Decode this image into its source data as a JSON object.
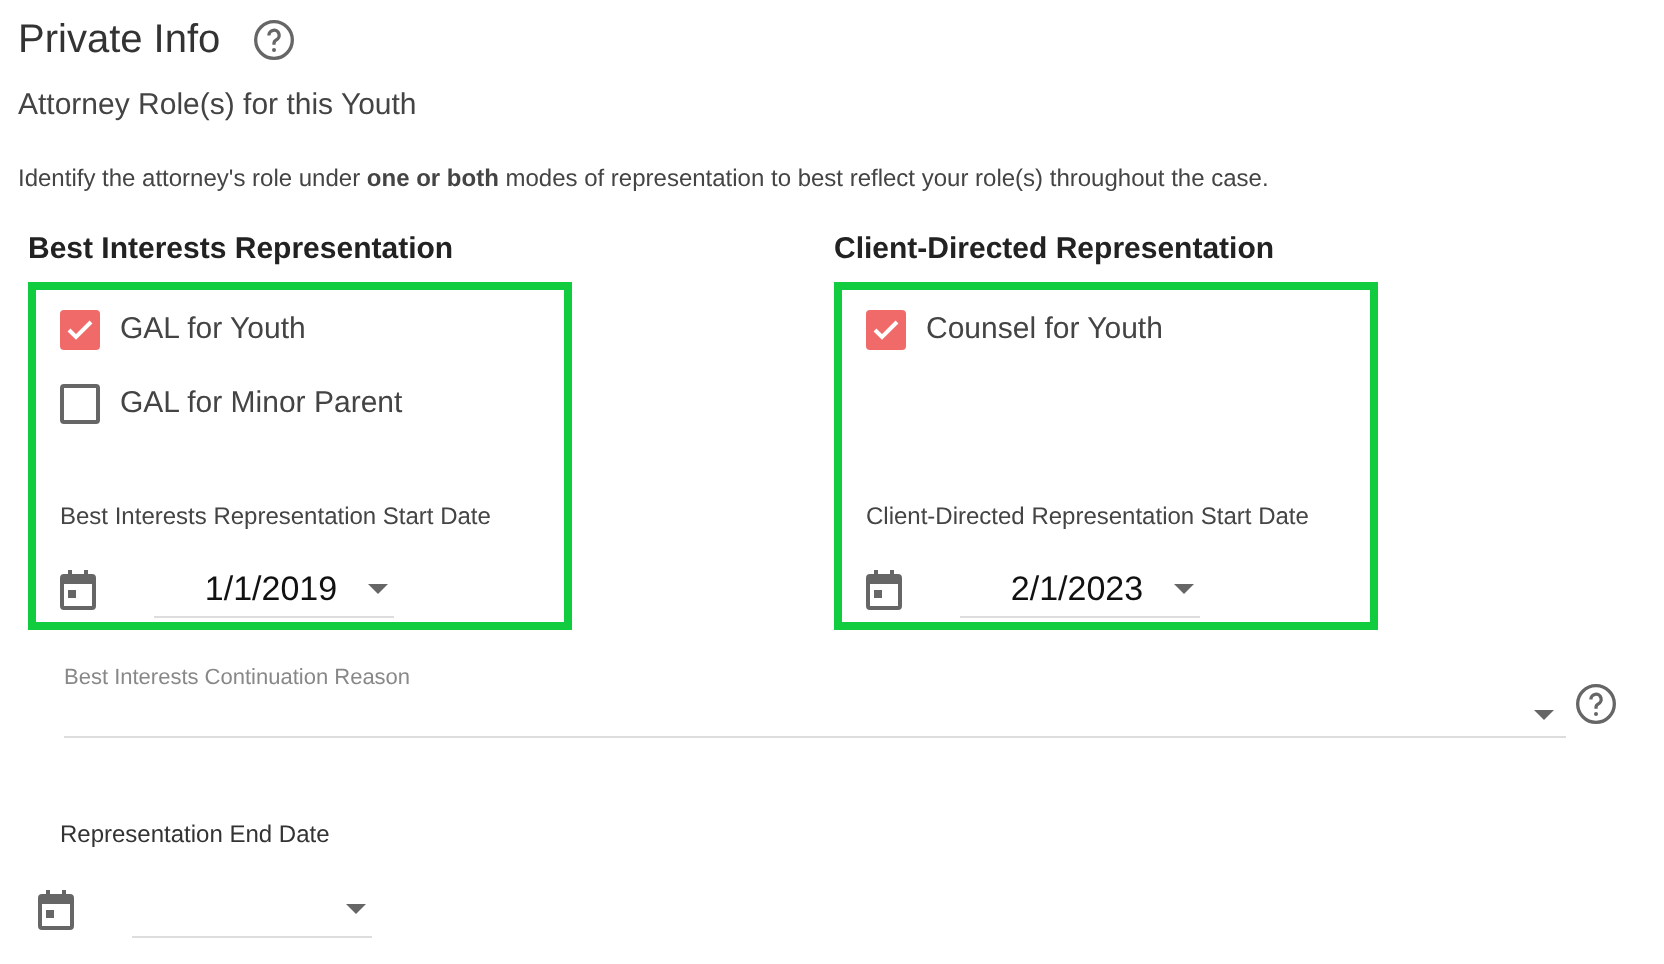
{
  "title": "Private Info",
  "subtitle": "Attorney Role(s) for this Youth",
  "instructions": "Identify the attorney's role under **one or both** modes of representation to best reflect your role(s) throughout the case.",
  "sections": [
    {
      "heading": "Best Interests Representation",
      "options": [
        {
          "label": "GAL for Youth",
          "checked": true
        },
        {
          "label": "GAL for Minor Parent",
          "checked": false
        }
      ],
      "date_label": "Best Interests Representation Start Date",
      "date_value": "1/1/2019"
    },
    {
      "heading": "Client-Directed Representation",
      "options": [
        {
          "label": "Counsel for Youth",
          "checked": true
        }
      ],
      "date_label": "Client-Directed Representation Start Date",
      "date_value": "2/1/2023"
    }
  ],
  "continuation_reason": {
    "label": "Best Interests Continuation Reason"
  },
  "end_date": {
    "label": "Representation End Date"
  }
}
